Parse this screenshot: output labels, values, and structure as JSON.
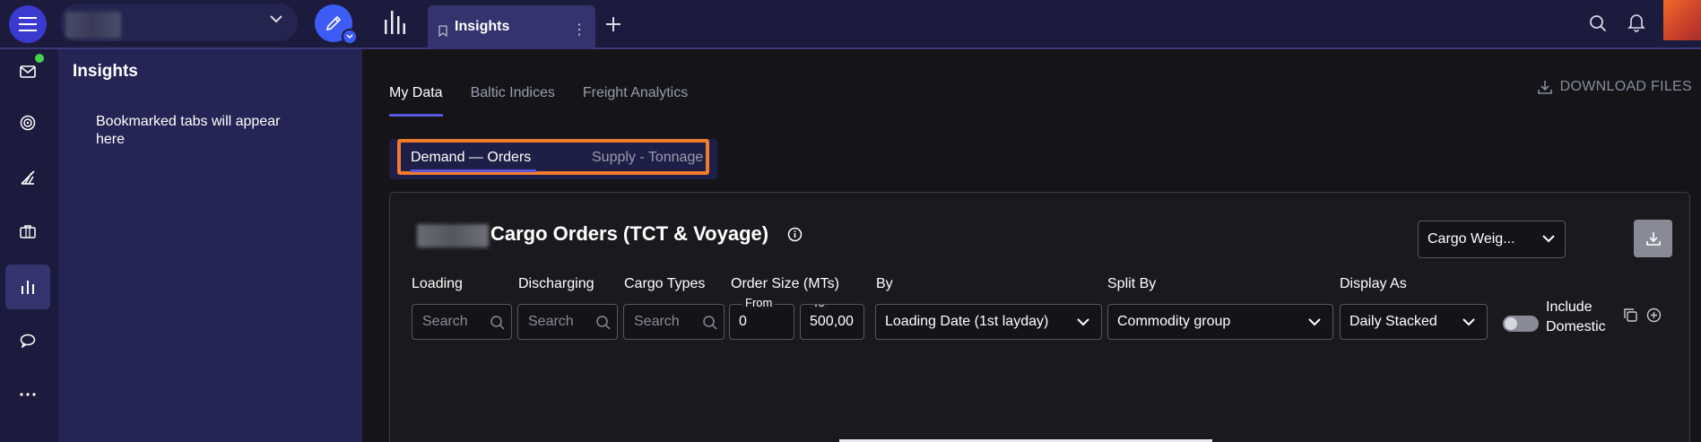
{
  "topbar": {
    "active_tab_label": "Insights",
    "tab_menu_glyph": "⋮"
  },
  "panel": {
    "title": "Insights",
    "empty_message": "Bookmarked tabs will appear here"
  },
  "main": {
    "tabs": [
      {
        "label": "My Data",
        "active": true
      },
      {
        "label": "Baltic Indices",
        "active": false
      },
      {
        "label": "Freight Analytics",
        "active": false
      }
    ],
    "download_files_label": "DOWNLOAD FILES",
    "subtabs": [
      {
        "label": "Demand — Orders",
        "active": true
      },
      {
        "label": "Supply - Tonnage",
        "active": false
      }
    ]
  },
  "card": {
    "title": "Cargo Orders (TCT & Voyage)",
    "metric_select_value": "Cargo Weig...",
    "filters": {
      "loading_label": "Loading",
      "loading_placeholder": "Search",
      "discharging_label": "Discharging",
      "discharging_placeholder": "Search",
      "cargo_types_label": "Cargo Types",
      "cargo_types_placeholder": "Search",
      "order_size_label": "Order Size (MTs)",
      "from_label": "From",
      "from_value": "0",
      "to_label": "To",
      "to_value": "500,00",
      "by_label": "By",
      "by_value": "Loading Date (1st layday)",
      "split_by_label": "Split By",
      "split_by_value": "Commodity group",
      "display_as_label": "Display As",
      "display_as_value": "Daily Stacked",
      "include_domestic_label": "Include Domestic",
      "include_domestic_on": false
    }
  },
  "colors": {
    "accent": "#3d5cf5",
    "highlight_border": "#f07b2d",
    "nav_bg": "#1c1b3d",
    "panel_bg": "#252454",
    "online_status": "#46d24a"
  },
  "icons": {
    "menu": "hamburger-icon",
    "compose": "pencil-icon",
    "analytics": "bar-chart-icon",
    "bookmark": "bookmark-icon",
    "add": "plus-icon",
    "search": "search-icon",
    "notifications": "bell-icon",
    "mail": "mail-icon",
    "download": "download-icon",
    "info": "info-icon",
    "copy": "copy-icon",
    "add_circle": "plus-circle-icon"
  }
}
